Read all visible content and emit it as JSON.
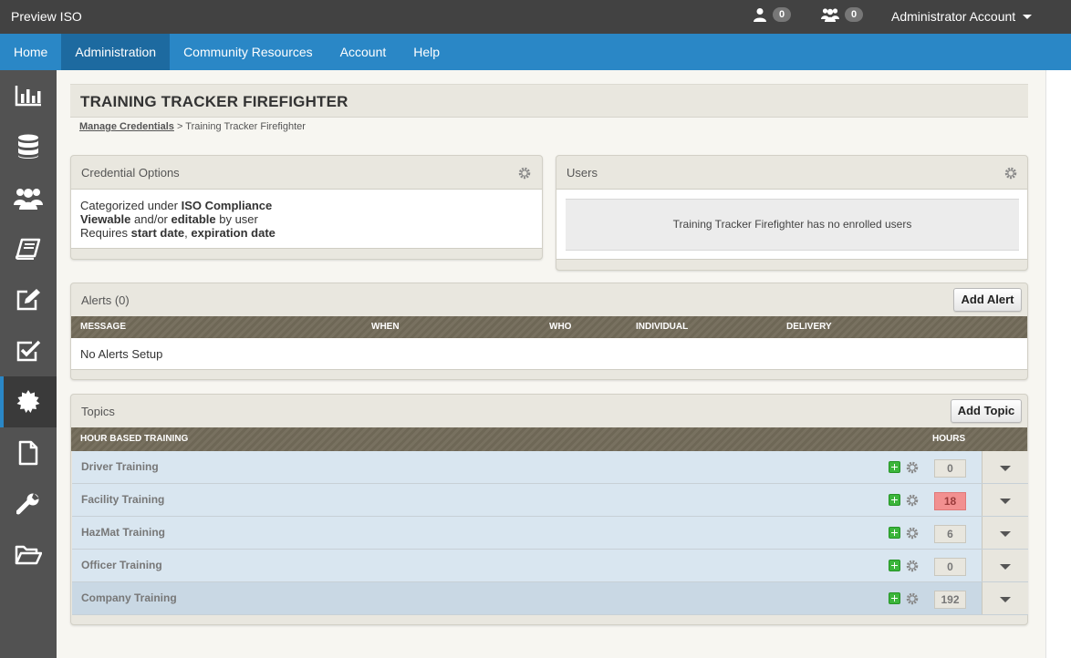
{
  "topbar": {
    "brand": "Preview ISO",
    "user_count": "0",
    "group_count": "0",
    "account_label": "Administrator Account"
  },
  "nav": [
    "Home",
    "Administration",
    "Community Resources",
    "Account",
    "Help"
  ],
  "nav_active": "Administration",
  "sidebar": [
    {
      "name": "reports",
      "icon": "bar-chart-icon"
    },
    {
      "name": "database",
      "icon": "database-icon"
    },
    {
      "name": "users",
      "icon": "users-icon"
    },
    {
      "name": "library",
      "icon": "book-icon"
    },
    {
      "name": "edit",
      "icon": "edit-icon"
    },
    {
      "name": "checklist",
      "icon": "checkbox-icon"
    },
    {
      "name": "credentials",
      "icon": "badge-icon",
      "active": true
    },
    {
      "name": "documents",
      "icon": "document-icon"
    },
    {
      "name": "tools",
      "icon": "wrench-icon"
    },
    {
      "name": "folders",
      "icon": "folder-icon"
    }
  ],
  "page": {
    "title": "TRAINING TRACKER FIREFIGHTER",
    "breadcrumb_link": "Manage Credentials",
    "breadcrumb_sep": " > ",
    "breadcrumb_current": "Training Tracker Firefighter"
  },
  "credential_options": {
    "title": "Credential Options",
    "line1_a": "Categorized under ",
    "line1_b": "ISO Compliance",
    "line2_a": "Viewable",
    "line2_b": " and/or ",
    "line2_c": "editable",
    "line2_d": " by user",
    "line3_a": "Requires ",
    "line3_b": "start date",
    "line3_c": ", ",
    "line3_d": "expiration date"
  },
  "users_panel": {
    "title": "Users",
    "empty": "Training Tracker Firefighter has no enrolled users"
  },
  "alerts": {
    "title": "Alerts (0)",
    "add_label": "Add Alert",
    "columns": {
      "message": "MESSAGE",
      "when": "WHEN",
      "who": "WHO",
      "individual": "INDIVIDUAL",
      "delivery": "DELIVERY"
    },
    "empty": "No Alerts Setup"
  },
  "topics": {
    "title": "Topics",
    "add_label": "Add Topic",
    "col_training": "HOUR BASED TRAINING",
    "col_hours": "HOURS",
    "rows": [
      {
        "name": "Driver Training",
        "hours": "0"
      },
      {
        "name": "Facility Training",
        "hours": "18",
        "warn": true
      },
      {
        "name": "HazMat Training",
        "hours": "6"
      },
      {
        "name": "Officer Training",
        "hours": "0"
      },
      {
        "name": "Company Training",
        "hours": "192",
        "alt": true
      }
    ]
  },
  "colors": {
    "nav_blue": "#2a87c6",
    "topbar": "#424242",
    "sidebar": "#525252",
    "warn": "#f29090",
    "add_green": "#3bb53b"
  }
}
